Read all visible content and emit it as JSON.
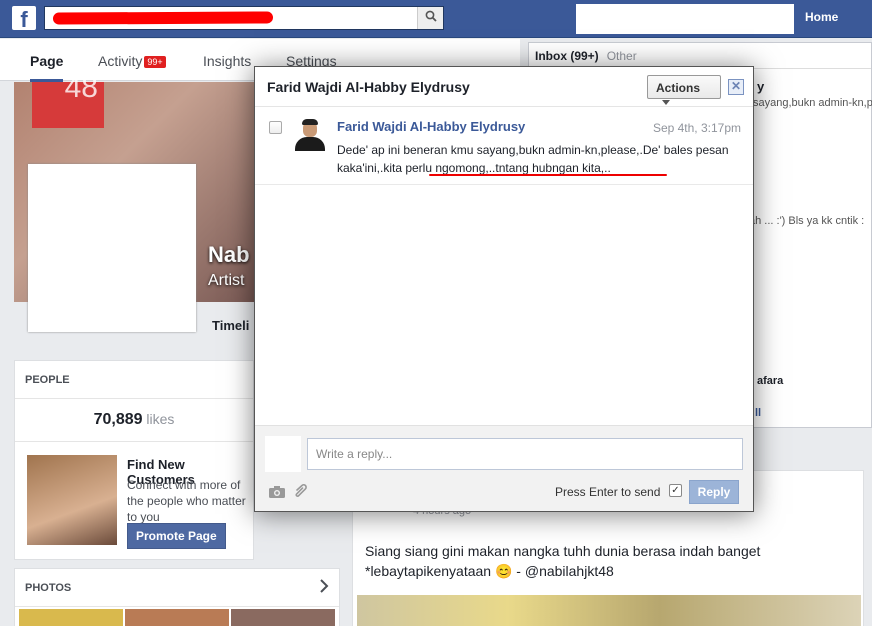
{
  "topbar": {
    "logo_letter": "f",
    "search_icon": "search-icon",
    "home_label": "Home"
  },
  "page_nav": {
    "tabs": [
      {
        "label": "Page",
        "active": true
      },
      {
        "label": "Activity",
        "badge": "99+"
      },
      {
        "label": "Insights"
      },
      {
        "label": "Settings"
      }
    ]
  },
  "cover": {
    "badge_text": "48",
    "name_fragment": "Nab",
    "subtitle_fragment": "Artist",
    "timeline_tab": "Timeli"
  },
  "people_card": {
    "heading": "PEOPLE",
    "likes_count": "70,889",
    "likes_unit": "likes",
    "promo_title": "Find New Customers",
    "promo_text": "Connect with more of the people who matter to you",
    "promo_button": "Promote Page"
  },
  "photos_card": {
    "heading": "PHOTOS",
    "chevron_icon": "chevron-right-icon"
  },
  "inbox": {
    "tab_inbox": "Inbox (99+)",
    "tab_other": "Other",
    "fragments": [
      "y",
      "sayang,bukn admin-kn,pl",
      "ah ... :') Bls ya kk cntik :",
      "afara",
      "ll"
    ]
  },
  "feed": {
    "time": "4 hours ago",
    "text": "Siang siang gini makan nangka tuhh dunia berasa indah banget *lebaytapikenyataan 😊 - @nabilahjkt48"
  },
  "modal": {
    "title": "Farid Wajdi Al-Habby Elydrusy",
    "actions_label": "Actions",
    "close_icon": "close-icon",
    "message": {
      "sender": "Farid Wajdi Al-Habby Elydrusy",
      "time": "Sep 4th, 3:17pm",
      "body": "Dede' ap ini beneran kmu sayang,bukn admin-kn,please,.De' bales pesan kaka'ini,.kita perlu ngomong,..tntang hubngan kita,.."
    },
    "reply": {
      "placeholder": "Write a reply...",
      "camera_icon": "camera-icon",
      "attach_icon": "paperclip-icon",
      "enter_label": "Press Enter to send",
      "enter_checked": true,
      "reply_button": "Reply"
    }
  },
  "colors": {
    "brand_blue": "#3b5998",
    "link_blue": "#3b5998",
    "reply_disabled": "#9cb4d8",
    "badge_red": "#e02020",
    "redaction_red": "#ff0000"
  }
}
